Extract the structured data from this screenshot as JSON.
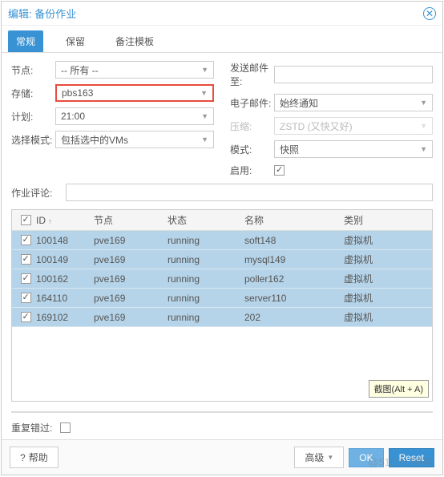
{
  "header": {
    "title": "编辑: 备份作业"
  },
  "tabs": {
    "t0": "常规",
    "t1": "保留",
    "t2": "备注模板"
  },
  "formLeft": {
    "node_lbl": "节点:",
    "node_val": "-- 所有 --",
    "storage_lbl": "存储:",
    "storage_val": "pbs163",
    "schedule_lbl": "计划:",
    "schedule_val": "21:00",
    "selmode_lbl": "选择模式:",
    "selmode_val": "包括选中的VMs"
  },
  "formRight": {
    "mail_lbl": "发送邮件至:",
    "mail_val": "",
    "email_lbl": "电子邮件:",
    "email_val": "始终通知",
    "comp_lbl": "压缩:",
    "comp_val": "ZSTD (又快又好)",
    "mode_lbl": "模式:",
    "mode_val": "快照",
    "enable_lbl": "启用:"
  },
  "comment": {
    "lbl": "作业评论:",
    "val": ""
  },
  "grid": {
    "h_id": "ID",
    "h_node": "节点",
    "h_status": "状态",
    "h_name": "名称",
    "h_type": "类别",
    "rows": [
      {
        "id": "100148",
        "node": "pve169",
        "status": "running",
        "name": "soft148",
        "type": "虚拟机"
      },
      {
        "id": "100149",
        "node": "pve169",
        "status": "running",
        "name": "mysql149",
        "type": "虚拟机"
      },
      {
        "id": "100162",
        "node": "pve169",
        "status": "running",
        "name": "poller162",
        "type": "虚拟机"
      },
      {
        "id": "164110",
        "node": "pve169",
        "status": "running",
        "name": "server110",
        "type": "虚拟机"
      },
      {
        "id": "169102",
        "node": "pve169",
        "status": "running",
        "name": "202",
        "type": "虚拟机"
      }
    ]
  },
  "hint": "截图(Alt + A)",
  "repeat": {
    "lbl": "重复错过:"
  },
  "footer": {
    "help": "帮助",
    "adv": "高级",
    "ok": "OK",
    "reset": "Reset"
  },
  "watermark": "@51CTO博客"
}
